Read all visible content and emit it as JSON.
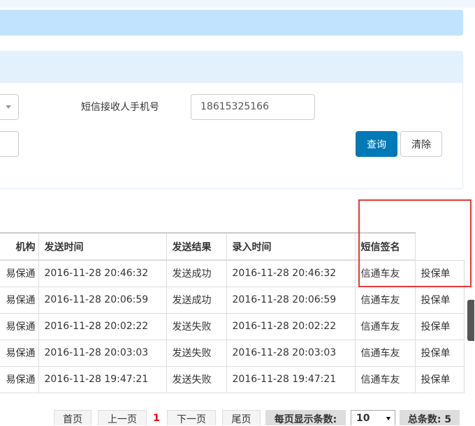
{
  "search": {
    "phone_label": "短信接收人手机号",
    "phone_value": "18615325166",
    "query_label": "查询",
    "clear_label": "清除"
  },
  "table": {
    "headers": [
      "机构",
      "发送时间",
      "发送结果",
      "录入时间",
      "短信签名"
    ],
    "rows": [
      [
        "易保通",
        "2016-11-28 20:46:32",
        "发送成功",
        "2016-11-28 20:46:32",
        "信通车友",
        "投保单"
      ],
      [
        "易保通",
        "2016-11-28 20:06:59",
        "发送成功",
        "2016-11-28 20:06:59",
        "信通车友",
        "投保单"
      ],
      [
        "易保通",
        "2016-11-28 20:02:22",
        "发送失败",
        "2016-11-28 20:02:22",
        "信通车友",
        "投保单"
      ],
      [
        "易保通",
        "2016-11-28 20:03:03",
        "发送失败",
        "2016-11-28 20:03:03",
        "信通车友",
        "投保单"
      ],
      [
        "易保通",
        "2016-11-28 19:47:21",
        "发送失败",
        "2016-11-28 19:47:21",
        "信通车友",
        "投保单"
      ]
    ]
  },
  "pagination": {
    "first": "首页",
    "prev": "上一页",
    "current": "1",
    "next": "下一页",
    "last": "尾页",
    "per_page_label": "每页显示条数:",
    "per_page_value": "10",
    "total_label": "总条数: 5"
  }
}
